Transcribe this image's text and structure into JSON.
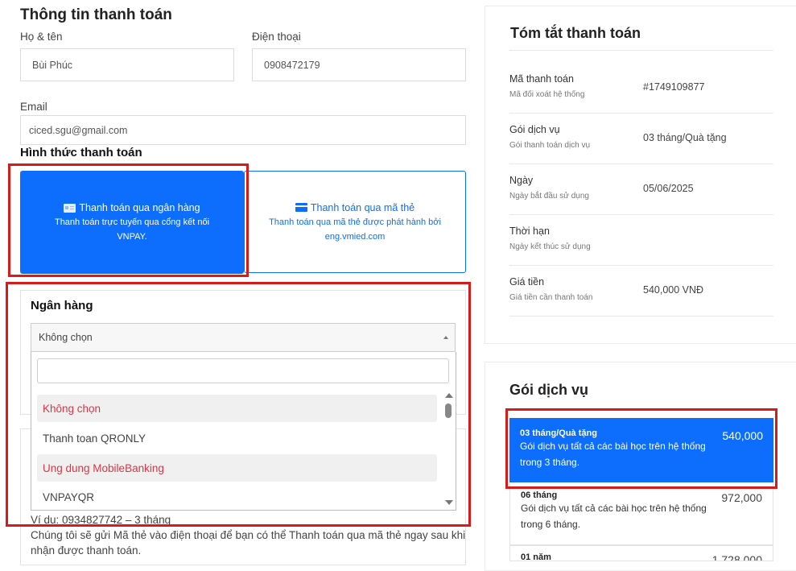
{
  "billing": {
    "title": "Thông tin thanh toán",
    "name_label": "Họ & tên",
    "name_value": "Bùi Phúc",
    "phone_label": "Điện thoại",
    "phone_value": "0908472179",
    "email_label": "Email",
    "email_value": "ciced.sgu@gmail.com"
  },
  "payment_method": {
    "title": "Hình thức thanh toán",
    "bank": {
      "icon": "bank-card-icon",
      "title": "Thanh toán qua ngân hàng",
      "desc_line1": "Thanh toán trực tuyến qua cổng kết nối",
      "desc_line2": "VNPAY."
    },
    "card": {
      "icon": "credit-card-icon",
      "title": "Thanh toán qua mã thẻ",
      "desc_line1": "Thanh toán qua mã thẻ được phát hành bởi",
      "desc_line2": "eng.vmied.com"
    }
  },
  "bank_select": {
    "title": "Ngân hàng",
    "selected": "Không chọn",
    "search_value": "",
    "options": [
      {
        "label": "Không chọn"
      },
      {
        "label": "Thanh toan QRONLY"
      },
      {
        "label": "Ung dung MobileBanking"
      },
      {
        "label": "VNPAYQR"
      }
    ]
  },
  "card_note": {
    "example": "Ví dụ: 0934827742 – 3 tháng",
    "line1": "Chúng tôi sẽ gửi Mã thẻ vào điện thoại để bạn có thể Thanh toán qua mã thẻ ngay sau khi",
    "line2": "nhận được thanh toán."
  },
  "summary": {
    "title": "Tóm tắt thanh toán",
    "rows": [
      {
        "label": "Mã thanh toán",
        "sub": "Mã đối xoát hệ thống",
        "value": "#1749109877"
      },
      {
        "label": "Gói dịch vụ",
        "sub": "Gói thanh toán dịch vụ",
        "value": "03 tháng/Quà tặng"
      },
      {
        "label": "Ngày",
        "sub": "Ngày bắt đầu sử dụng",
        "value": "05/06/2025"
      },
      {
        "label": "Thời hạn",
        "sub": "Ngày kết thúc sử dụng",
        "value": ""
      },
      {
        "label": "Giá tiền",
        "sub": "Giá tiền cần thanh toán",
        "value": "540,000 VNĐ"
      }
    ]
  },
  "packages": {
    "title": "Gói dịch vụ",
    "items": [
      {
        "name": "03 tháng/Quà tặng",
        "desc_line1": "Gói dịch vụ tất cả các bài học trên hệ thống",
        "desc_line2": "trong 3 tháng.",
        "price": "540,000"
      },
      {
        "name": "06 tháng",
        "desc_line1": "Gói dịch vụ tất cả các bài học trên hệ thống",
        "desc_line2": "trong 6 tháng.",
        "price": "972,000"
      },
      {
        "name": "01 năm",
        "desc_line1": "",
        "desc_line2": "",
        "price": "1,728,000"
      }
    ]
  },
  "colors": {
    "accent": "#0d6efd",
    "highlight_frame": "#d71a1a",
    "option_red": "#dc3545"
  }
}
